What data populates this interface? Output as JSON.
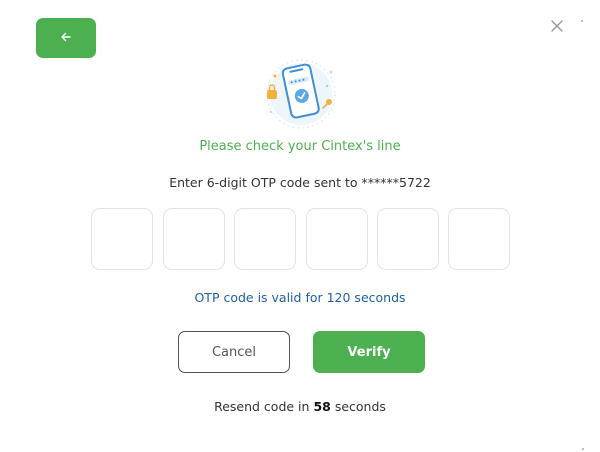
{
  "header": {
    "back_icon": "arrow-left-icon",
    "close_icon": "close-icon"
  },
  "illustration": {
    "icon": "phone-verification-illustration"
  },
  "content": {
    "headline": "Please check your Cintex's line",
    "instruction": "Enter 6-digit OTP code sent to ******5722",
    "otp_boxes": [
      "",
      "",
      "",
      "",
      "",
      ""
    ],
    "validity": "OTP code is valid for 120 seconds"
  },
  "actions": {
    "cancel_label": "Cancel",
    "verify_label": "Verify"
  },
  "resend": {
    "prefix": "Resend code in",
    "seconds": "58",
    "suffix": "seconds"
  },
  "colors": {
    "accent": "#4caf50",
    "info": "#1f5fa8"
  }
}
